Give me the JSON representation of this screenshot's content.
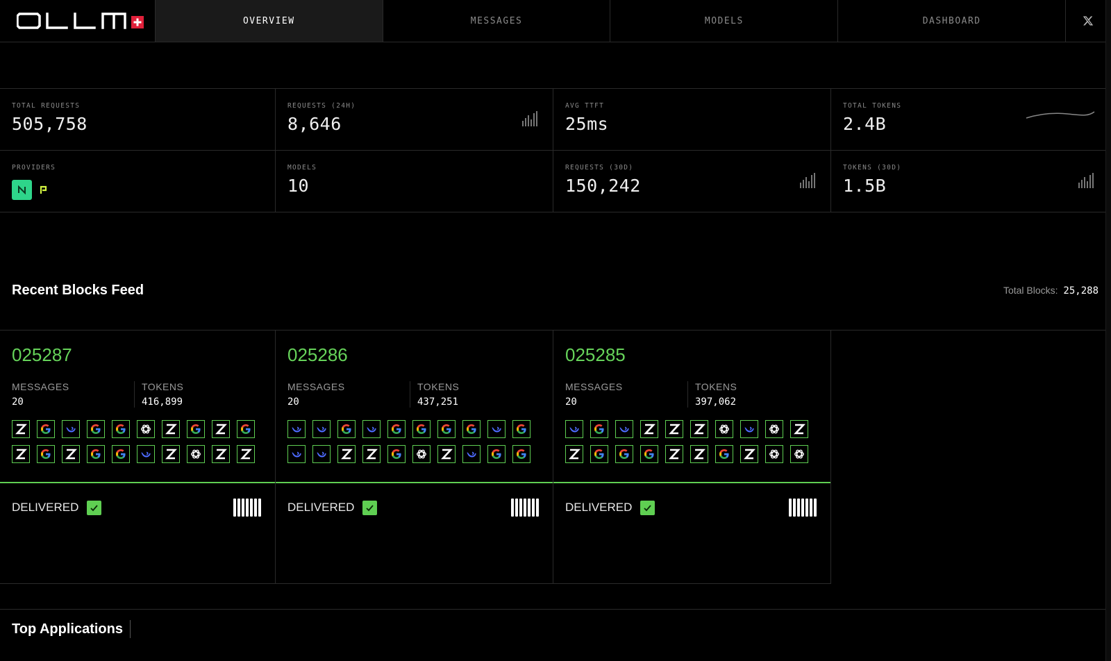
{
  "brand": {
    "logo_text": "OLLM"
  },
  "nav": {
    "tabs": [
      {
        "label": "OVERVIEW",
        "active": true
      },
      {
        "label": "MESSAGES",
        "active": false
      },
      {
        "label": "MODELS",
        "active": false
      },
      {
        "label": "DASHBOARD",
        "active": false
      }
    ],
    "x_icon": "x-logo-icon"
  },
  "stats": {
    "total_requests": {
      "label": "TOTAL REQUESTS",
      "value": "505,758"
    },
    "requests_24h": {
      "label": "REQUESTS (24H)",
      "value": "8,646",
      "icon": "bar-chart-icon"
    },
    "avg_ttft": {
      "label": "AVG TTFT",
      "value": "25ms"
    },
    "total_tokens": {
      "label": "TOTAL TOKENS",
      "value": "2.4B",
      "icon": "sparkline-icon"
    },
    "providers": {
      "label": "PROVIDERS",
      "icons": [
        "provider-n-icon",
        "provider-p-icon"
      ]
    },
    "models": {
      "label": "MODELS",
      "value": "10"
    },
    "requests_30d": {
      "label": "REQUESTS (30D)",
      "value": "150,242",
      "icon": "bar-chart-icon"
    },
    "tokens_30d": {
      "label": "TOKENS (30D)",
      "value": "1.5B",
      "icon": "bar-chart-icon"
    }
  },
  "recent_blocks": {
    "title": "Recent Blocks Feed",
    "total_label": "Total Blocks:",
    "total_value": "25,288",
    "messages_label": "MESSAGES",
    "tokens_label": "TOKENS",
    "status_label": "DELIVERED",
    "blocks": [
      {
        "id": "025287",
        "messages": "20",
        "tokens": "416,899",
        "models": [
          "z",
          "g",
          "d",
          "g",
          "g",
          "o",
          "z",
          "g",
          "z",
          "g",
          "z",
          "g",
          "z",
          "g",
          "g",
          "d",
          "z",
          "o",
          "z",
          "z"
        ]
      },
      {
        "id": "025286",
        "messages": "20",
        "tokens": "437,251",
        "models": [
          "d",
          "d",
          "g",
          "d",
          "g",
          "g",
          "g",
          "g",
          "d",
          "g",
          "d",
          "d",
          "z",
          "z",
          "g",
          "o",
          "z",
          "d",
          "g",
          "g"
        ]
      },
      {
        "id": "025285",
        "messages": "20",
        "tokens": "397,062",
        "models": [
          "d",
          "g",
          "d",
          "z",
          "z",
          "z",
          "o",
          "d",
          "o",
          "z",
          "z",
          "g",
          "g",
          "g",
          "z",
          "z",
          "g",
          "z",
          "o",
          "o"
        ]
      }
    ]
  },
  "top_applications": {
    "title": "Top Applications"
  },
  "colors": {
    "accent_green": "#5fcf52",
    "provider_n": "#2ed58a",
    "provider_p": "#d4f542",
    "deepseek_blue": "#4d6bfe",
    "google_blue": "#4285f4",
    "google_red": "#ea4335",
    "google_yellow": "#fbbc05",
    "google_green": "#34a853"
  }
}
